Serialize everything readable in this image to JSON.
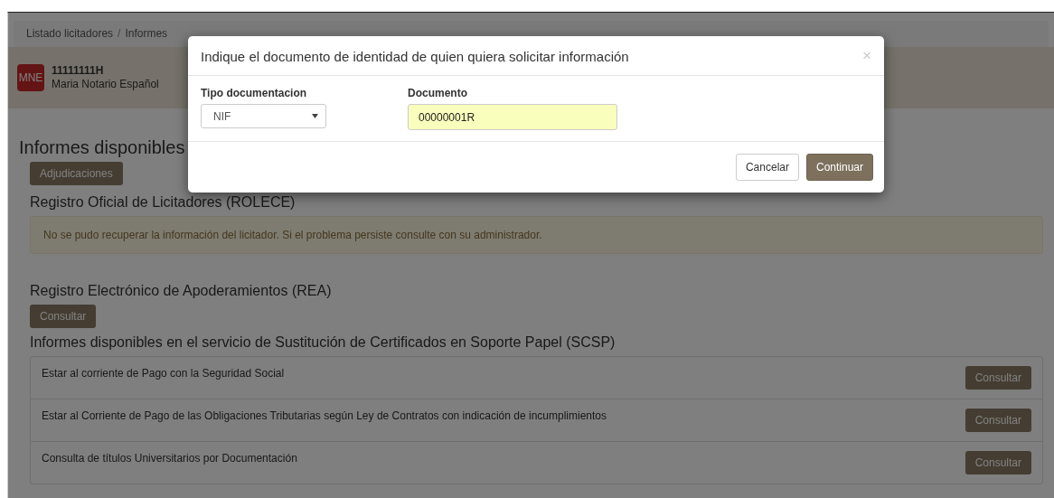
{
  "breadcrumb": {
    "separator": "/",
    "items": [
      {
        "label": "Listado licitadores"
      },
      {
        "label": "Informes"
      }
    ]
  },
  "user": {
    "initials": "MNE",
    "id": "11111111H",
    "name": "Maria Notario Español"
  },
  "page_title": "Informes disponibles",
  "top_button": "Adjudicaciones",
  "sections": [
    {
      "kind": "alert",
      "title": "Registro Oficial de Licitadores (ROLECE)",
      "message": "No se pudo recuperar la información del licitador. Si el problema persiste consulte con su administrador."
    },
    {
      "kind": "button",
      "title": "Registro Electrónico de Apoderamientos (REA)",
      "button": "Consultar"
    },
    {
      "kind": "list",
      "title": "Informes disponibles en el servicio de Sustitución de Certificados en Soporte Papel (SCSP)",
      "rows": [
        {
          "label": "Estar al corriente de Pago con la Seguridad Social",
          "button": "Consultar"
        },
        {
          "label": "Estar al Corriente de Pago de las Obligaciones Tributarias según Ley de Contratos con indicación de incumplimientos",
          "button": "Consultar"
        },
        {
          "label": "Consulta de títulos Universitarios por Documentación",
          "button": "Consultar"
        }
      ]
    }
  ],
  "modal": {
    "title": "Indique el documento de identidad de quien quiera solicitar información",
    "close": "×",
    "fields": [
      {
        "kind": "select",
        "label": "Tipo documentacion",
        "value": "NIF",
        "autofilled": false
      },
      {
        "kind": "text",
        "label": "Documento",
        "value": "00000001R",
        "autofilled": true
      }
    ],
    "buttons": [
      {
        "label": "Cancelar",
        "kind": "default"
      },
      {
        "label": "Continuar",
        "kind": "primary"
      }
    ]
  }
}
